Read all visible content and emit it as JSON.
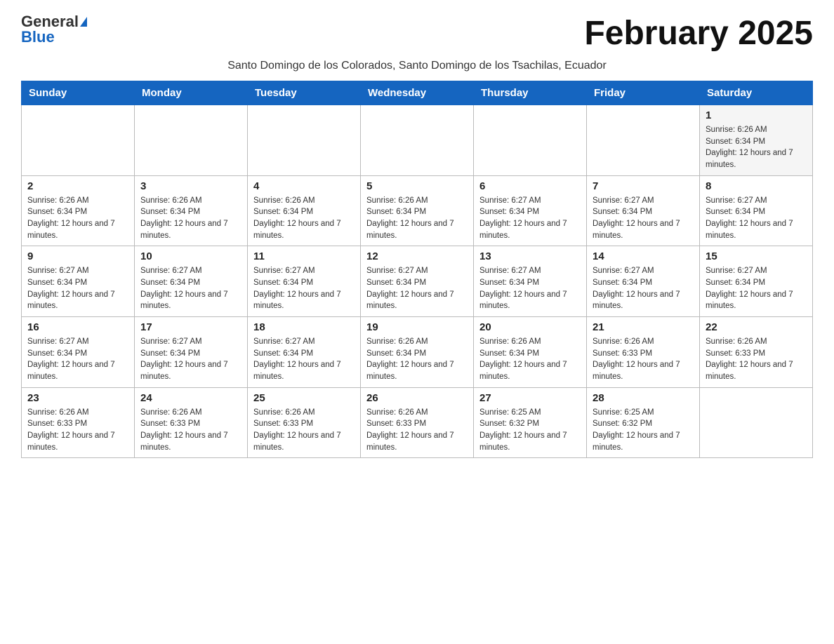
{
  "header": {
    "logo_general": "General",
    "logo_blue": "Blue",
    "month_title": "February 2025"
  },
  "subtitle": "Santo Domingo de los Colorados, Santo Domingo de los Tsachilas, Ecuador",
  "weekdays": [
    "Sunday",
    "Monday",
    "Tuesday",
    "Wednesday",
    "Thursday",
    "Friday",
    "Saturday"
  ],
  "weeks": [
    {
      "shaded": false,
      "days": [
        {
          "num": "",
          "info": ""
        },
        {
          "num": "",
          "info": ""
        },
        {
          "num": "",
          "info": ""
        },
        {
          "num": "",
          "info": ""
        },
        {
          "num": "",
          "info": ""
        },
        {
          "num": "",
          "info": ""
        },
        {
          "num": "1",
          "info": "Sunrise: 6:26 AM\nSunset: 6:34 PM\nDaylight: 12 hours and 7 minutes."
        }
      ]
    },
    {
      "shaded": false,
      "days": [
        {
          "num": "2",
          "info": "Sunrise: 6:26 AM\nSunset: 6:34 PM\nDaylight: 12 hours and 7 minutes."
        },
        {
          "num": "3",
          "info": "Sunrise: 6:26 AM\nSunset: 6:34 PM\nDaylight: 12 hours and 7 minutes."
        },
        {
          "num": "4",
          "info": "Sunrise: 6:26 AM\nSunset: 6:34 PM\nDaylight: 12 hours and 7 minutes."
        },
        {
          "num": "5",
          "info": "Sunrise: 6:26 AM\nSunset: 6:34 PM\nDaylight: 12 hours and 7 minutes."
        },
        {
          "num": "6",
          "info": "Sunrise: 6:27 AM\nSunset: 6:34 PM\nDaylight: 12 hours and 7 minutes."
        },
        {
          "num": "7",
          "info": "Sunrise: 6:27 AM\nSunset: 6:34 PM\nDaylight: 12 hours and 7 minutes."
        },
        {
          "num": "8",
          "info": "Sunrise: 6:27 AM\nSunset: 6:34 PM\nDaylight: 12 hours and 7 minutes."
        }
      ]
    },
    {
      "shaded": false,
      "days": [
        {
          "num": "9",
          "info": "Sunrise: 6:27 AM\nSunset: 6:34 PM\nDaylight: 12 hours and 7 minutes."
        },
        {
          "num": "10",
          "info": "Sunrise: 6:27 AM\nSunset: 6:34 PM\nDaylight: 12 hours and 7 minutes."
        },
        {
          "num": "11",
          "info": "Sunrise: 6:27 AM\nSunset: 6:34 PM\nDaylight: 12 hours and 7 minutes."
        },
        {
          "num": "12",
          "info": "Sunrise: 6:27 AM\nSunset: 6:34 PM\nDaylight: 12 hours and 7 minutes."
        },
        {
          "num": "13",
          "info": "Sunrise: 6:27 AM\nSunset: 6:34 PM\nDaylight: 12 hours and 7 minutes."
        },
        {
          "num": "14",
          "info": "Sunrise: 6:27 AM\nSunset: 6:34 PM\nDaylight: 12 hours and 7 minutes."
        },
        {
          "num": "15",
          "info": "Sunrise: 6:27 AM\nSunset: 6:34 PM\nDaylight: 12 hours and 7 minutes."
        }
      ]
    },
    {
      "shaded": false,
      "days": [
        {
          "num": "16",
          "info": "Sunrise: 6:27 AM\nSunset: 6:34 PM\nDaylight: 12 hours and 7 minutes."
        },
        {
          "num": "17",
          "info": "Sunrise: 6:27 AM\nSunset: 6:34 PM\nDaylight: 12 hours and 7 minutes."
        },
        {
          "num": "18",
          "info": "Sunrise: 6:27 AM\nSunset: 6:34 PM\nDaylight: 12 hours and 7 minutes."
        },
        {
          "num": "19",
          "info": "Sunrise: 6:26 AM\nSunset: 6:34 PM\nDaylight: 12 hours and 7 minutes."
        },
        {
          "num": "20",
          "info": "Sunrise: 6:26 AM\nSunset: 6:34 PM\nDaylight: 12 hours and 7 minutes."
        },
        {
          "num": "21",
          "info": "Sunrise: 6:26 AM\nSunset: 6:33 PM\nDaylight: 12 hours and 7 minutes."
        },
        {
          "num": "22",
          "info": "Sunrise: 6:26 AM\nSunset: 6:33 PM\nDaylight: 12 hours and 7 minutes."
        }
      ]
    },
    {
      "shaded": false,
      "days": [
        {
          "num": "23",
          "info": "Sunrise: 6:26 AM\nSunset: 6:33 PM\nDaylight: 12 hours and 7 minutes."
        },
        {
          "num": "24",
          "info": "Sunrise: 6:26 AM\nSunset: 6:33 PM\nDaylight: 12 hours and 7 minutes."
        },
        {
          "num": "25",
          "info": "Sunrise: 6:26 AM\nSunset: 6:33 PM\nDaylight: 12 hours and 7 minutes."
        },
        {
          "num": "26",
          "info": "Sunrise: 6:26 AM\nSunset: 6:33 PM\nDaylight: 12 hours and 7 minutes."
        },
        {
          "num": "27",
          "info": "Sunrise: 6:25 AM\nSunset: 6:32 PM\nDaylight: 12 hours and 7 minutes."
        },
        {
          "num": "28",
          "info": "Sunrise: 6:25 AM\nSunset: 6:32 PM\nDaylight: 12 hours and 7 minutes."
        },
        {
          "num": "",
          "info": ""
        }
      ]
    }
  ]
}
